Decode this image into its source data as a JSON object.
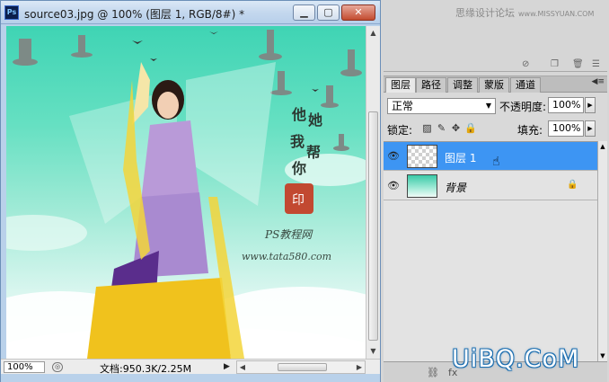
{
  "document_window": {
    "app_badge": "Ps",
    "title": "source03.jpg @ 100% (图层 1, RGB/8#) *",
    "buttons": {
      "minimize": "▁",
      "maximize": "▢",
      "close": "✕"
    }
  },
  "canvas_artwork": {
    "calligraphy": [
      "他",
      "她",
      "我",
      "帮",
      "你"
    ],
    "seal_text": "印",
    "caption_line1": "PS教程网",
    "caption_line2": "www.tata580.com"
  },
  "status_bar": {
    "zoom": "100%",
    "doc_size": "文档:950.3K/2.25M"
  },
  "top_panel": {
    "watermark_text": "思缘设计论坛",
    "watermark_small": "www.MISSYUAN.COM"
  },
  "layers_panel": {
    "tabs": [
      "图层",
      "路径",
      "调整",
      "蒙版",
      "通道"
    ],
    "active_tab": "图层",
    "blend_mode": "正常",
    "opacity_label": "不透明度:",
    "opacity_value": "100%",
    "lock_label": "锁定:",
    "fill_label": "填充:",
    "fill_value": "100%",
    "layers": [
      {
        "name": "图层 1",
        "selected": true,
        "visible": true,
        "locked": false
      },
      {
        "name": "背景",
        "selected": false,
        "visible": true,
        "locked": true
      }
    ]
  },
  "watermark_logo": "UiBQ.CoM",
  "colors": {
    "selection": "#3d95f3",
    "panel_bg": "#d6d6d6",
    "titlebar": "#c4d8ee"
  }
}
